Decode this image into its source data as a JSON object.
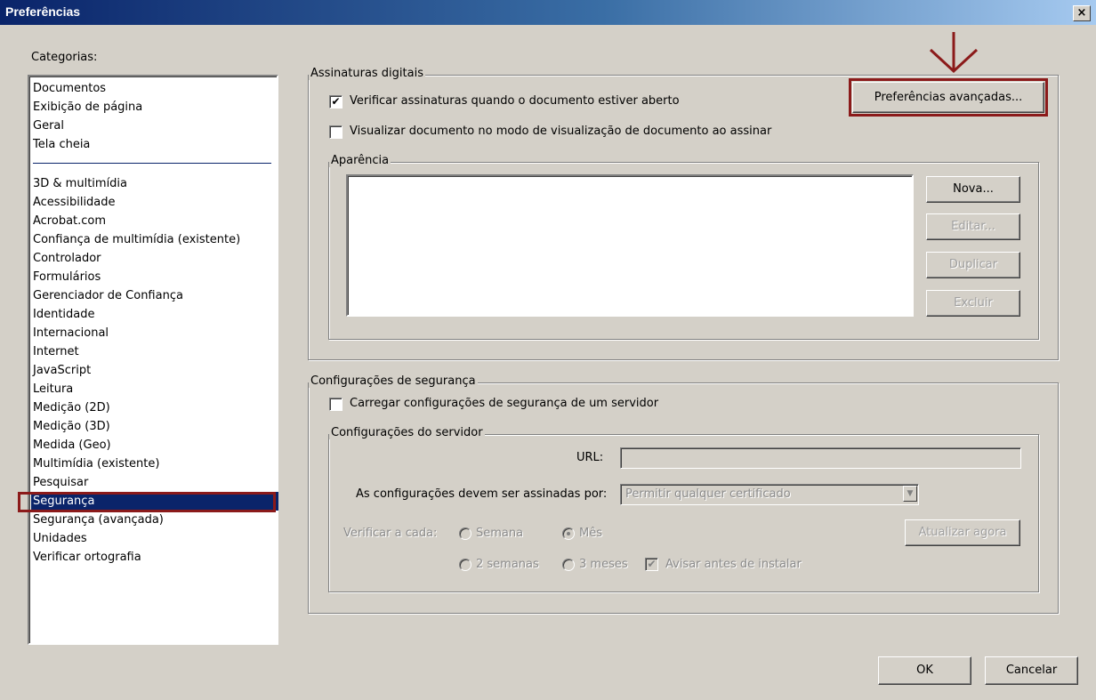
{
  "window": {
    "title": "Preferências",
    "close": "×"
  },
  "categories": {
    "label": "Categorias:",
    "group1": [
      "Documentos",
      "Exibição de página",
      "Geral",
      "Tela cheia"
    ],
    "group2": [
      "3D & multimídia",
      "Acessibilidade",
      "Acrobat.com",
      "Confiança de multimídia (existente)",
      "Controlador",
      "Formulários",
      "Gerenciador de Confiança",
      "Identidade",
      "Internacional",
      "Internet",
      "JavaScript",
      "Leitura",
      "Medição (2D)",
      "Medição (3D)",
      "Medida (Geo)",
      "Multimídia (existente)",
      "Pesquisar",
      "Segurança",
      "Segurança (avançada)",
      "Unidades",
      "Verificar ortografia"
    ],
    "selected": "Segurança"
  },
  "digital_signatures": {
    "title": "Assinaturas digitais",
    "verify_label": "Verificar assinaturas quando o documento estiver aberto",
    "verify_checked": true,
    "preview_label": "Visualizar documento no modo de visualização de documento ao assinar",
    "preview_checked": false,
    "advanced_button": "Preferências avançadas...",
    "appearance": {
      "title": "Aparência",
      "new_button": "Nova...",
      "edit_button": "Editar...",
      "duplicate_button": "Duplicar",
      "delete_button": "Excluir"
    }
  },
  "security_settings": {
    "title": "Configurações de segurança",
    "load_label": "Carregar configurações de segurança de um servidor",
    "load_checked": false,
    "server": {
      "title": "Configurações do servidor",
      "url_label": "URL:",
      "url_value": "",
      "signed_by_label": "As configurações devem ser assinadas por:",
      "signed_by_value": "Permitir qualquer certificado",
      "check_every_label": "Verificar a cada:",
      "week": "Semana",
      "month": "Mês",
      "two_weeks": "2 semanas",
      "three_months": "3 meses",
      "selected_interval": "Mês",
      "warn_label": "Avisar antes de instalar",
      "warn_checked": true,
      "update_now_button": "Atualizar agora"
    }
  },
  "footer": {
    "ok": "OK",
    "cancel": "Cancelar"
  },
  "annotation": {
    "arrow_color": "#8b1a1a",
    "highlight_color": "#8b1a1a",
    "arrow_icon": "arrow-down-icon"
  }
}
